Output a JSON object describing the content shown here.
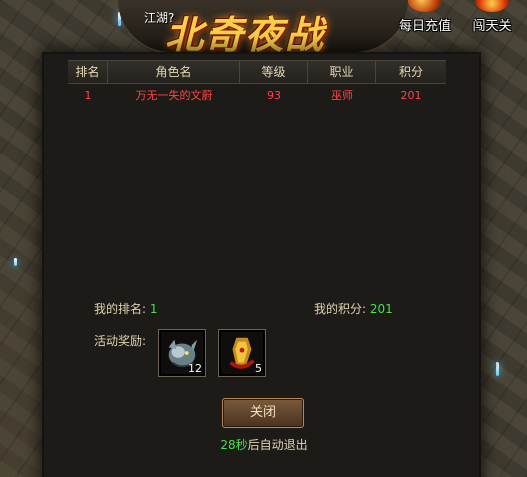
{
  "header": {
    "server_name": "江湖?",
    "title": "北奇夜战",
    "buttons": [
      {
        "label": "每日充值",
        "icon": "gem-bag-icon"
      },
      {
        "label": "闯天关",
        "icon": "flame-gate-icon"
      }
    ]
  },
  "ranking": {
    "columns": [
      "排名",
      "角色名",
      "等级",
      "职业",
      "积分"
    ],
    "rows": [
      {
        "rank": "1",
        "name": "万无一失的文蔚",
        "level": "93",
        "class": "巫师",
        "score": "201"
      }
    ]
  },
  "my_stats": {
    "rank_label": "我的排名:",
    "rank_value": "1",
    "score_label": "我的积分:",
    "score_value": "201"
  },
  "rewards": {
    "label": "活动奖励:",
    "items": [
      {
        "icon": "dragon-head-icon",
        "count": "12"
      },
      {
        "icon": "armor-gauntlet-icon",
        "count": "5"
      }
    ]
  },
  "footer": {
    "close_label": "关闭",
    "countdown_seconds": "28秒",
    "countdown_text": "后自动退出"
  },
  "colors": {
    "row_text": "#ff4444",
    "number_green": "#49e04a",
    "title_gold": "#f8d04a"
  }
}
